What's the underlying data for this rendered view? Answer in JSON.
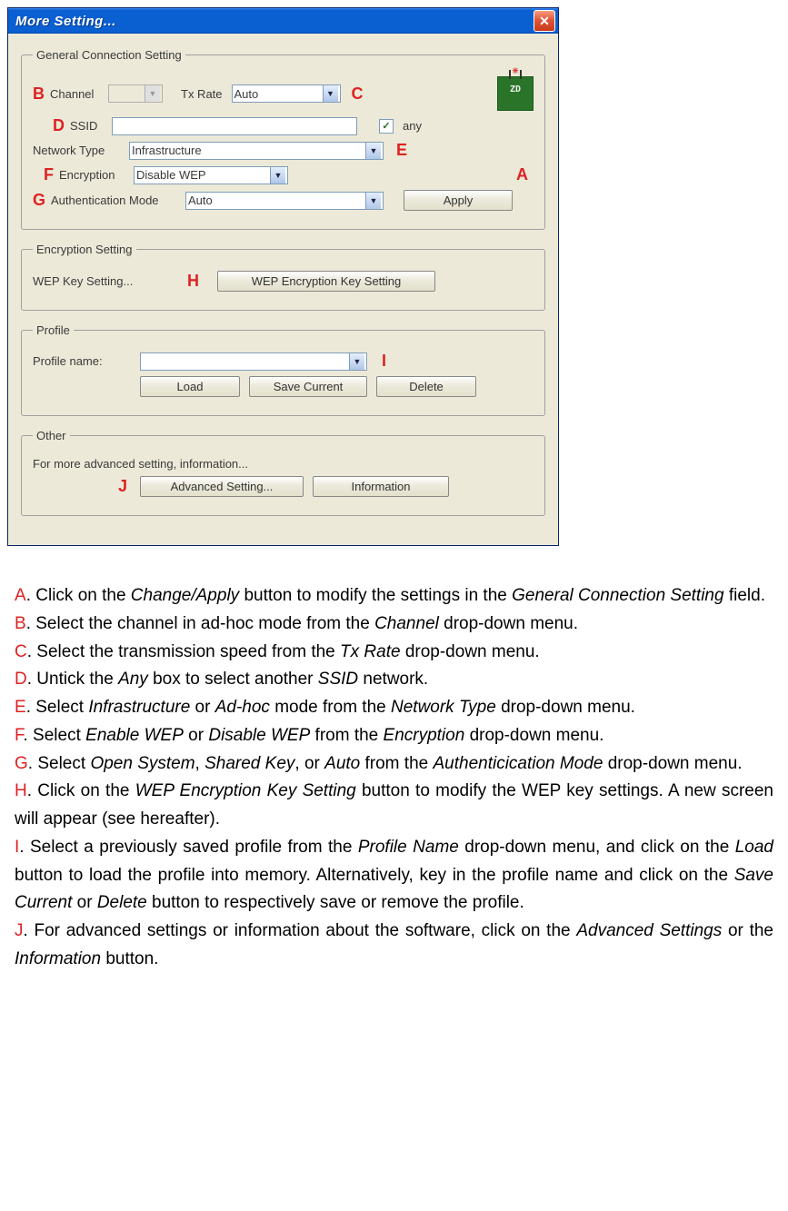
{
  "window": {
    "title": "More Setting...",
    "close_glyph": "✕"
  },
  "markers": {
    "A": "A",
    "B": "B",
    "C": "C",
    "D": "D",
    "E": "E",
    "F": "F",
    "G": "G",
    "H": "H",
    "I": "I",
    "J": "J"
  },
  "general": {
    "legend": "General Connection Setting",
    "channel_label": "Channel",
    "channel_value": "",
    "txrate_label": "Tx Rate",
    "txrate_value": "Auto",
    "ssid_label": "SSID",
    "ssid_value": "",
    "any_label": "any",
    "any_checked": "✓",
    "nettype_label": "Network Type",
    "nettype_value": "Infrastructure",
    "enc_label": "Encryption",
    "enc_value": "Disable WEP",
    "auth_label": "Authentication Mode",
    "auth_value": "Auto",
    "apply_btn": "Apply"
  },
  "enc_setting": {
    "legend": "Encryption Setting",
    "wep_label": "WEP Key Setting...",
    "wep_btn": "WEP Encryption Key Setting"
  },
  "profile": {
    "legend": "Profile",
    "name_label": "Profile name:",
    "name_value": "",
    "load_btn": "Load",
    "save_btn": "Save Current",
    "delete_btn": "Delete"
  },
  "other": {
    "legend": "Other",
    "text": "For more advanced setting, information...",
    "adv_btn": "Advanced Setting...",
    "info_btn": "Information"
  },
  "instructions": {
    "A": ". Click on the <em>Change/Apply</em> button to modify the settings in the <em>General Connection Setting</em> field.",
    "B": ". Select the channel in ad-hoc mode from the <em>Channel</em> drop-down menu.",
    "C": ". Select the transmission speed from the <em>Tx Rate</em> drop-down menu.",
    "D": ". Untick the <em>Any</em> box to select another <em>SSID</em> network.",
    "E": ". Select <em>Infrastructure</em> or <em>Ad-hoc</em> mode from the <em>Network Type</em> drop-down menu.",
    "F": ". Select <em>Enable WEP</em> or <em>Disable WEP</em> from the <em>Encryption</em> drop-down menu.",
    "G": ". Select <em>Open System</em>, <em>Shared Key</em>, or <em>Auto</em> from the <em>Authenticication Mode</em> drop-down menu.",
    "H": ". Click on the <em>WEP Encryption Key Setting</em> button to modify the WEP key settings. A new screen will appear (see hereafter).",
    "I": ". Select a previously saved profile from the <em>Profile Name</em> drop-down menu, and click on the <em>Load</em> button to load the profile into memory. Alternatively, key in the profile name and click on the <em>Save Current</em> or <em>Delete</em> button to respectively save or remove the profile.",
    "J": ". For advanced settings or information about the software, click on the <em>Advanced Settings</em> or the <em>Information</em> button."
  }
}
